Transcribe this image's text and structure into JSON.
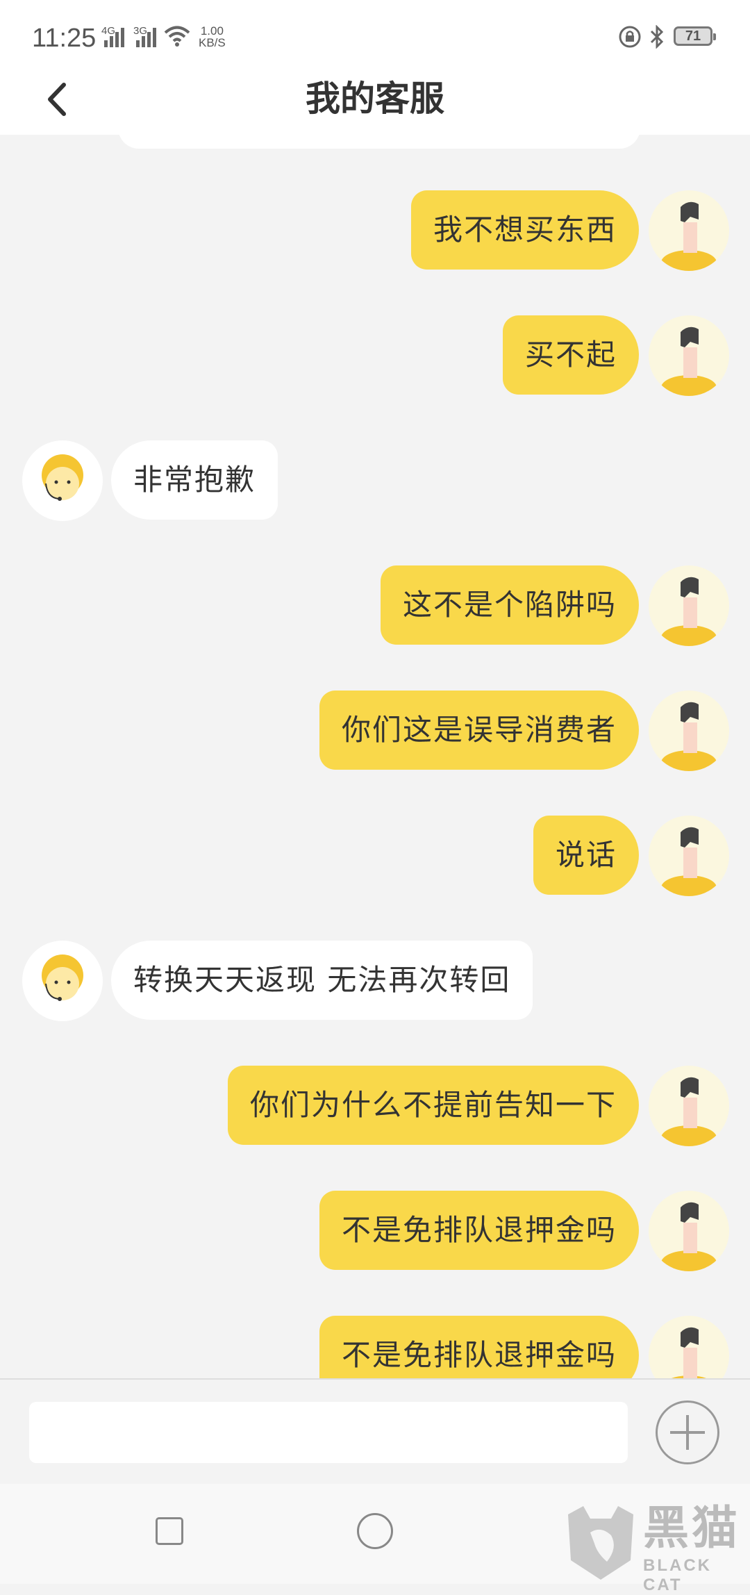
{
  "status_bar": {
    "time": "11:25",
    "net1": "4G",
    "net2": "3G",
    "speed_value": "1.00",
    "speed_unit": "KB/S",
    "battery": "71"
  },
  "header": {
    "title": "我的客服"
  },
  "messages": [
    {
      "side": "right",
      "text": "我不想买东西"
    },
    {
      "side": "right",
      "text": "买不起"
    },
    {
      "side": "left",
      "text": "非常抱歉"
    },
    {
      "side": "right",
      "text": "这不是个陷阱吗"
    },
    {
      "side": "right",
      "text": "你们这是误导消费者"
    },
    {
      "side": "right",
      "text": "说话"
    },
    {
      "side": "left",
      "text": "转换天天返现 无法再次转回"
    },
    {
      "side": "right",
      "text": "你们为什么不提前告知一下"
    },
    {
      "side": "right",
      "text": "不是免排队退押金吗"
    },
    {
      "side": "right",
      "text": "不是免排队退押金吗"
    }
  ],
  "input": {
    "value": "",
    "placeholder": ""
  },
  "watermark": {
    "cn": "黑猫",
    "en": "BLACK CAT"
  },
  "colors": {
    "user_bubble": "#f9d84a",
    "agent_bubble": "#ffffff",
    "background": "#f3f3f3"
  },
  "icons": {
    "back": "chevron-left-icon",
    "add": "plus-icon",
    "user_avatar": "user-avatar",
    "agent_avatar": "agent-avatar"
  }
}
